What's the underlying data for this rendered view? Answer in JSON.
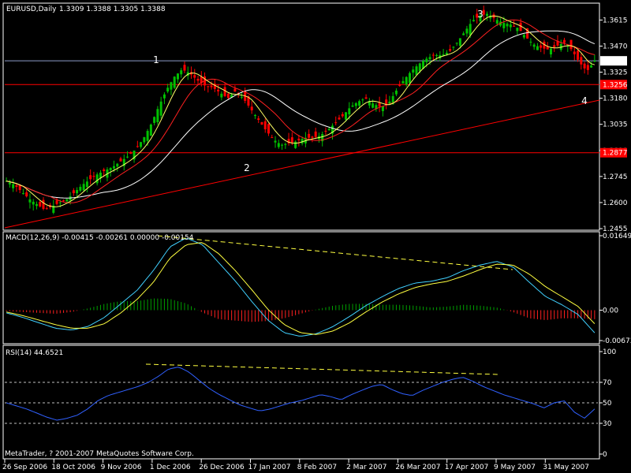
{
  "colors": {
    "background": "#000000",
    "frame": "#ffffff",
    "bull_candle": "#00c000",
    "bear_candle": "#ff0000",
    "horizontal_line": "#ff0000",
    "current_price_line": "#8c9cc8",
    "trendline": "#ff0000",
    "ma_fast": "#ffff66",
    "ma_slow": "#ffffff",
    "ma_mid": "#ff2020",
    "macd_main": "#40d0ff",
    "macd_signal": "#ffff40",
    "macd_hist_pos": "#00a000",
    "macd_hist_neg": "#ff2020",
    "divergence": "#ffff40",
    "rsi_line": "#3060ff",
    "wave_label": "#ffd700"
  },
  "header": {
    "symbol": "EURUSD,Daily",
    "ohlc": "1.3309 1.3388 1.3305 1.3388"
  },
  "macd_label": "MACD(12,26,9) -0.00415 -0.00261 0.00000 -0.00154",
  "rsi_label": "RSI(14) 44.6521",
  "footer": "MetaTrader, ? 2001-2007 MetaQuotes Software Corp.",
  "chart_data": [
    {
      "type": "candlestick",
      "title": "EURUSD,Daily",
      "ylim": [
        1.2455,
        1.37
      ],
      "y_ticks": [
        "1.3615",
        "1.3470",
        "1.3325",
        "1.3180",
        "1.3035",
        "1.2890",
        "1.2745",
        "1.2600",
        "1.2455"
      ],
      "x_ticks": [
        "26 Sep 2006",
        "18 Oct 2006",
        "9 Nov 2006",
        "1 Dec 2006",
        "26 Dec 2006",
        "17 Jan 2007",
        "8 Feb 2007",
        "2 Mar 2007",
        "26 Mar 2007",
        "17 Apr 2007",
        "9 May 2007",
        "31 May 2007"
      ],
      "price_labels": {
        "current": "1.3388",
        "upper_line": "1.3256",
        "lower_line": "1.2877"
      },
      "horizontal_lines": [
        1.3256,
        1.2877
      ],
      "current_price": 1.3388,
      "wave_labels": [
        "1",
        "2",
        "3",
        "4"
      ],
      "close_path": [
        1.272,
        1.27,
        1.266,
        1.262,
        1.259,
        1.256,
        1.258,
        1.26,
        1.262,
        1.266,
        1.27,
        1.273,
        1.276,
        1.278,
        1.28,
        1.283,
        1.286,
        1.29,
        1.296,
        1.304,
        1.314,
        1.323,
        1.33,
        1.334,
        1.332,
        1.328,
        1.325,
        1.324,
        1.321,
        1.318,
        1.322,
        1.318,
        1.312,
        1.306,
        1.3,
        1.295,
        1.292,
        1.293,
        1.294,
        1.296,
        1.296,
        1.297,
        1.3,
        1.304,
        1.308,
        1.313,
        1.316,
        1.318,
        1.315,
        1.313,
        1.315,
        1.322,
        1.328,
        1.333,
        1.337,
        1.34,
        1.342,
        1.342,
        1.344,
        1.349,
        1.355,
        1.361,
        1.364,
        1.365,
        1.362,
        1.36,
        1.359,
        1.357,
        1.352,
        1.348,
        1.346,
        1.345,
        1.347,
        1.349,
        1.345,
        1.338,
        1.333,
        1.3388
      ]
    },
    {
      "type": "line",
      "title": "MACD(12,26,9)",
      "ylim": [
        -0.00673,
        0.01649
      ],
      "y_ticks": [
        "0.01649",
        "0.00",
        "-0.00673"
      ],
      "series": [
        {
          "name": "main",
          "values": [
            -0.0006,
            -0.0016,
            -0.0028,
            -0.004,
            -0.0044,
            -0.0036,
            -0.0016,
            0.0014,
            0.0044,
            0.0088,
            0.014,
            0.016,
            0.0145,
            0.0105,
            0.0065,
            0.002,
            -0.0022,
            -0.005,
            -0.0058,
            -0.0052,
            -0.0036,
            -0.0014,
            0.001,
            0.003,
            0.0048,
            0.006,
            0.0064,
            0.0072,
            0.0088,
            0.01,
            0.0108,
            0.0096,
            0.0062,
            0.003,
            0.0012,
            -0.001,
            -0.005
          ]
        },
        {
          "name": "signal",
          "values": [
            -0.0004,
            -0.0012,
            -0.0022,
            -0.0032,
            -0.004,
            -0.004,
            -0.003,
            -0.0006,
            0.0024,
            0.0062,
            0.0115,
            0.0145,
            0.015,
            0.0125,
            0.0088,
            0.0046,
            0.0002,
            -0.0032,
            -0.005,
            -0.0054,
            -0.0046,
            -0.0028,
            -0.0004,
            0.0018,
            0.0036,
            0.005,
            0.0058,
            0.0064,
            0.0076,
            0.009,
            0.0102,
            0.01,
            0.008,
            0.0052,
            0.003,
            0.0008,
            -0.003
          ]
        }
      ],
      "histogram": [
        -0.0002,
        -0.0004,
        -0.0006,
        -0.0008,
        -0.0004,
        0.0004,
        0.0014,
        0.002,
        0.002,
        0.0026,
        0.0025,
        0.0015,
        -0.0005,
        -0.002,
        -0.0023,
        -0.0026,
        -0.0024,
        -0.0018,
        -0.0008,
        0.0002,
        0.001,
        0.0014,
        0.0014,
        0.0012,
        0.0012,
        0.001,
        0.0006,
        0.0008,
        0.0012,
        0.001,
        0.0006,
        -0.0004,
        -0.0018,
        -0.0022,
        -0.0018,
        -0.0018,
        -0.002
      ]
    },
    {
      "type": "line",
      "title": "RSI(14)",
      "ylim": [
        0,
        100
      ],
      "y_ticks": [
        "100",
        "70",
        "50",
        "30",
        "0"
      ],
      "levels": [
        70,
        50,
        30
      ],
      "series": [
        {
          "name": "RSI",
          "values": [
            50,
            47,
            44,
            40,
            36,
            33,
            35,
            38,
            44,
            52,
            57,
            60,
            63,
            66,
            70,
            76,
            83,
            85,
            80,
            72,
            64,
            58,
            53,
            48,
            45,
            42,
            44,
            47,
            50,
            52,
            55,
            58,
            56,
            53,
            58,
            62,
            66,
            68,
            63,
            59,
            57,
            62,
            66,
            70,
            73,
            75,
            71,
            66,
            62,
            58,
            55,
            52,
            49,
            45,
            50,
            52,
            41,
            35,
            44
          ]
        }
      ]
    }
  ]
}
